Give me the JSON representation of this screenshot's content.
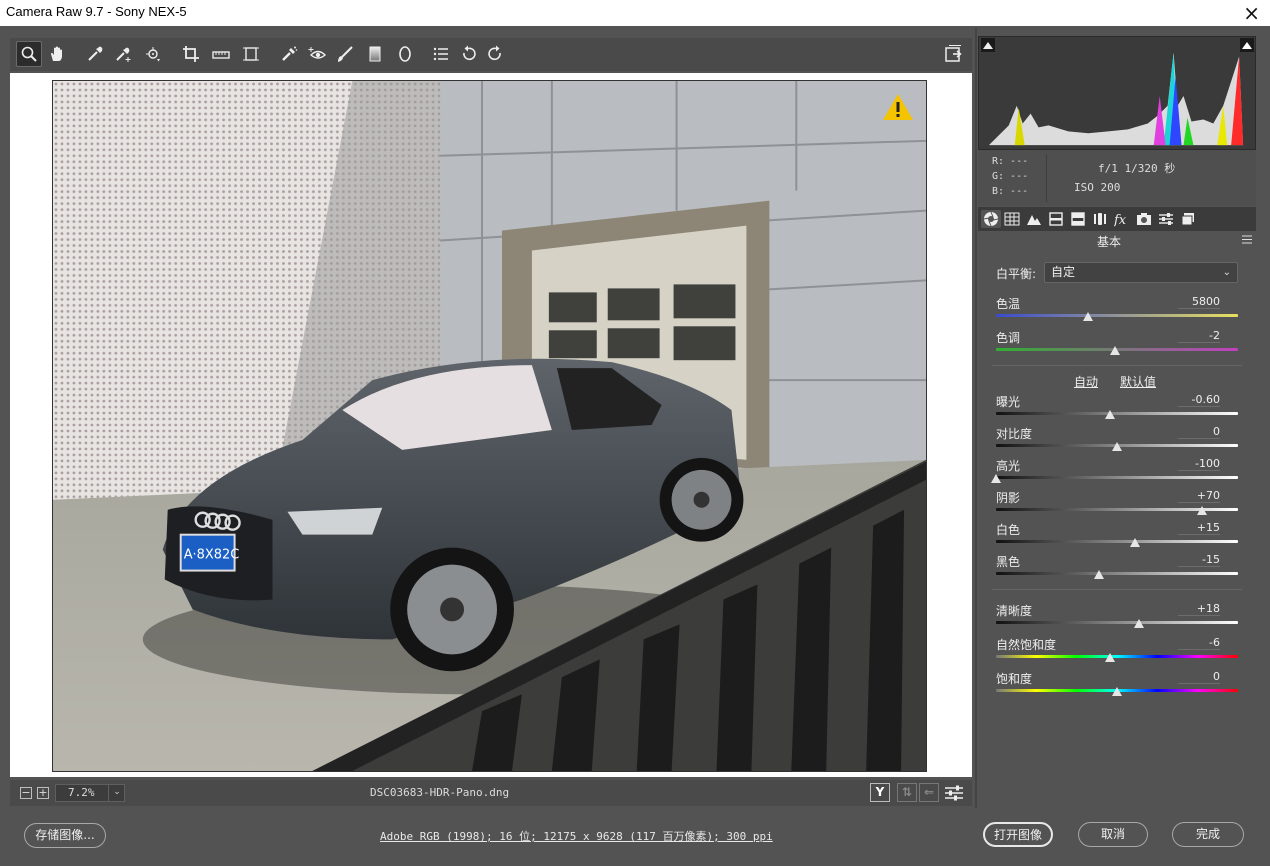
{
  "window": {
    "title": "Camera Raw 9.7 -  Sony NEX-5",
    "close": "×"
  },
  "toolbar": {
    "tools": [
      {
        "name": "zoom-tool",
        "icon": "magnifier-icon",
        "active": true
      },
      {
        "name": "hand-tool",
        "icon": "hand-icon"
      },
      {
        "name": "white-balance-tool",
        "icon": "eyedropper-icon"
      },
      {
        "name": "color-sampler-tool",
        "icon": "color-sampler-icon"
      },
      {
        "name": "targeted-adjustment-tool",
        "icon": "target-adjust-icon"
      },
      {
        "name": "crop-tool",
        "icon": "crop-icon"
      },
      {
        "name": "straighten-tool",
        "icon": "straighten-icon"
      },
      {
        "name": "transform-tool",
        "icon": "transform-icon"
      },
      {
        "name": "spot-removal-tool",
        "icon": "spot-removal-icon"
      },
      {
        "name": "red-eye-tool",
        "icon": "red-eye-icon"
      },
      {
        "name": "adjustment-brush-tool",
        "icon": "brush-icon"
      },
      {
        "name": "graduated-filter-tool",
        "icon": "graduated-filter-icon"
      },
      {
        "name": "radial-filter-tool",
        "icon": "radial-filter-icon"
      },
      {
        "name": "preferences-tool",
        "icon": "list-icon"
      },
      {
        "name": "rotate-left-tool",
        "icon": "rotate-ccw-icon"
      },
      {
        "name": "rotate-right-tool",
        "icon": "rotate-cw-icon"
      }
    ]
  },
  "statusbar": {
    "zoom_minus": "−",
    "zoom_plus": "+",
    "zoom": "7.2%",
    "filename": "DSC03683-HDR-Pano.dng",
    "y_label": "Y"
  },
  "bottom": {
    "save": "存储图像...",
    "workflow": "Adobe RGB (1998); 16 位; 12175 x 9628 (117 百万像素); 300 ppi",
    "open": "打开图像",
    "cancel": "取消",
    "done": "完成"
  },
  "info": {
    "r": "R:  ---",
    "g": "G:  ---",
    "b": "B:  ---",
    "exposure": "f/1   1/320 秒",
    "iso": "ISO 200"
  },
  "panel": {
    "title": "基本",
    "wb_label": "白平衡:",
    "wb_value": "自定",
    "auto": "自动",
    "default": "默认值",
    "sliders": [
      {
        "label": "色温",
        "value": "5800",
        "pos": 0.38
      },
      {
        "label": "色调",
        "value": "-2",
        "pos": 0.49
      },
      {
        "label": "曝光",
        "value": "-0.60",
        "pos": 0.47
      },
      {
        "label": "对比度",
        "value": "0",
        "pos": 0.5
      },
      {
        "label": "高光",
        "value": "-100",
        "pos": 0.0
      },
      {
        "label": "阴影",
        "value": "+70",
        "pos": 0.85
      },
      {
        "label": "白色",
        "value": "+15",
        "pos": 0.575
      },
      {
        "label": "黑色",
        "value": "-15",
        "pos": 0.425
      },
      {
        "label": "清晰度",
        "value": "+18",
        "pos": 0.59
      },
      {
        "label": "自然饱和度",
        "value": "-6",
        "pos": 0.47
      },
      {
        "label": "饱和度",
        "value": "0",
        "pos": 0.5
      }
    ]
  },
  "colors": {
    "accent_warning": "#f5c400",
    "plate": "#1b5fc4"
  }
}
